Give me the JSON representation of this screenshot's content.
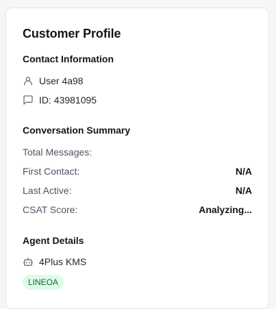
{
  "card": {
    "title": "Customer Profile"
  },
  "contact": {
    "heading": "Contact Information",
    "user_label": "User 4a98",
    "user_icon": "user-icon",
    "id_label": "ID: 43981095",
    "id_icon": "message-square-icon"
  },
  "summary": {
    "heading": "Conversation Summary",
    "stats": [
      {
        "label": "Total Messages:",
        "value": ""
      },
      {
        "label": "First Contact:",
        "value": "N/A"
      },
      {
        "label": "Last Active:",
        "value": "N/A"
      },
      {
        "label": "CSAT Score:",
        "value": "Analyzing..."
      }
    ]
  },
  "agent": {
    "heading": "Agent Details",
    "name": "4Plus KMS",
    "icon": "bot-icon",
    "channel_badge": "LINEOA",
    "badge_color": "#dcfce7",
    "badge_text_color": "#166534"
  }
}
